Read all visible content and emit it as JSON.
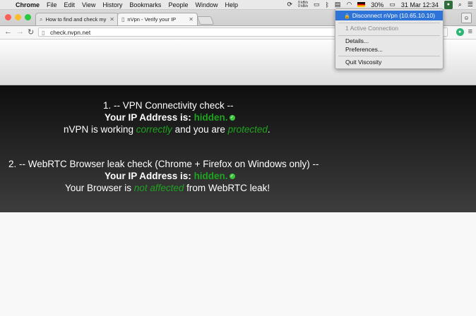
{
  "menubar": {
    "items": [
      "Chrome",
      "File",
      "Edit",
      "View",
      "History",
      "Bookmarks",
      "People",
      "Window",
      "Help"
    ],
    "net_up": "0 kB/s",
    "net_down": "0 kB/s",
    "battery": "30%",
    "datetime": "31 Mar  12:34"
  },
  "tabs": [
    {
      "label": "How to find and check my",
      "active": false
    },
    {
      "label": "nVpn - Verify your IP",
      "active": true
    }
  ],
  "omnibox": {
    "url": "check.nvpn.net"
  },
  "page": {
    "vpn": {
      "heading": "1. -- VPN Connectivity check --",
      "ip_label": "Your IP Address is:",
      "ip_value": "hidden.",
      "status_pre": "nVPN is working ",
      "status_mid1": "correctly",
      "status_mid2": " and you are ",
      "status_mid3": "protected",
      "status_end": "."
    },
    "webrtc": {
      "heading": "2. -- WebRTC Browser leak check (Chrome + Firefox on Windows only) --",
      "ip_label": "Your IP Address is:",
      "ip_value": "hidden.",
      "status_pre": "Your Browser is ",
      "status_mid": "not affected",
      "status_end": " from WebRTC leak!"
    }
  },
  "viscosity_menu": {
    "disconnect": "Disconnect nVpn (10.65.10.10)",
    "active": "1 Active Connection",
    "details": "Details...",
    "preferences": "Preferences...",
    "quit": "Quit Viscosity"
  },
  "colors": {
    "accent_green": "#1fa21f",
    "menu_highlight": "#2e73d8"
  }
}
